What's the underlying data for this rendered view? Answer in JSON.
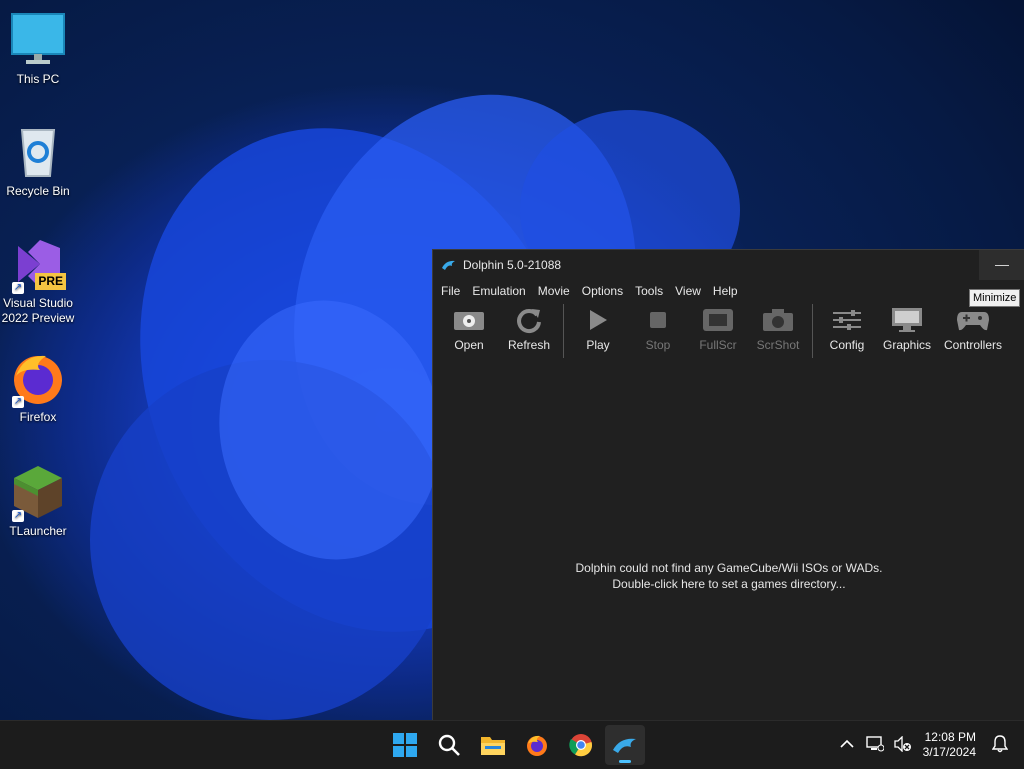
{
  "desktop": {
    "icons": [
      {
        "label": "This PC",
        "icon": "monitor-icon"
      },
      {
        "label": "Recycle Bin",
        "icon": "recycle-bin-icon"
      },
      {
        "label": "Visual Studio 2022 Preview",
        "icon": "visual-studio-icon",
        "badge": "PRE"
      },
      {
        "label": "Firefox",
        "icon": "firefox-icon"
      },
      {
        "label": "TLauncher",
        "icon": "minecraft-grass-block-icon"
      }
    ]
  },
  "window": {
    "title": "Dolphin 5.0-21088",
    "minimize_glyph": "—",
    "menu": [
      "File",
      "Emulation",
      "Movie",
      "Options",
      "Tools",
      "View",
      "Help"
    ],
    "toolbar": [
      {
        "label": "Open",
        "icon": "open-disc-icon",
        "enabled": true
      },
      {
        "label": "Refresh",
        "icon": "refresh-icon",
        "enabled": true
      },
      {
        "label": "Play",
        "icon": "play-icon",
        "enabled": true
      },
      {
        "label": "Stop",
        "icon": "stop-icon",
        "enabled": false
      },
      {
        "label": "FullScr",
        "icon": "fullscreen-icon",
        "enabled": false
      },
      {
        "label": "ScrShot",
        "icon": "camera-icon",
        "enabled": false
      },
      {
        "label": "Config",
        "icon": "sliders-icon",
        "enabled": true
      },
      {
        "label": "Graphics",
        "icon": "display-icon",
        "enabled": true
      },
      {
        "label": "Controllers",
        "icon": "gamepad-icon",
        "enabled": true
      }
    ],
    "empty_message_line1": "Dolphin could not find any GameCube/Wii ISOs or WADs.",
    "empty_message_line2": "Double-click here to set a games directory..."
  },
  "tooltip": "Minimize",
  "taskbar": {
    "apps": [
      "start-icon",
      "search-icon",
      "file-explorer-icon",
      "firefox-icon",
      "chrome-icon",
      "dolphin-icon"
    ],
    "active_app": "dolphin-icon",
    "time": "12:08 PM",
    "date": "3/17/2024"
  },
  "colors": {
    "window_bg": "#202020",
    "taskbar_bg": "#1c1c1c",
    "accent": "#4cc2ff",
    "wallpaper_blue": "#1c4ee8"
  }
}
